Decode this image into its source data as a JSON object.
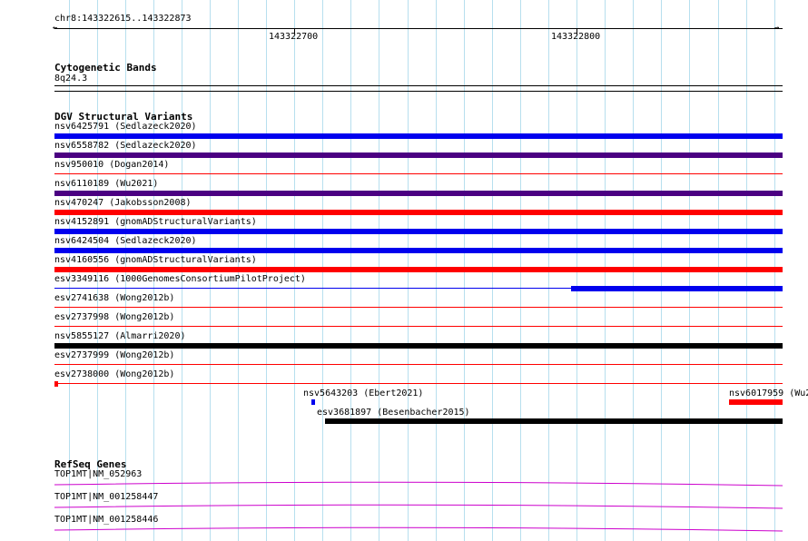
{
  "ruler": {
    "locus": "chr8:143322615..143322873",
    "ticks": [
      {
        "label": "143322700",
        "pos": 143322700
      },
      {
        "label": "143322800",
        "pos": 143322800
      }
    ],
    "start": 143322615,
    "end": 143322873,
    "left_arrow": "←",
    "right_arrow": "→"
  },
  "cytoband": {
    "title": "Cytogenetic Bands",
    "band": "8q24.3"
  },
  "dgv": {
    "title": "DGV Structural Variants",
    "colors": {
      "blue": "#0000ee",
      "purple": "#4b0082",
      "red": "#ff0000",
      "black": "#000000"
    },
    "tracks": [
      {
        "label": "nsv6425791 (Sedlazeck2020)",
        "color": "blue",
        "start": 143322615,
        "end": 143322873
      },
      {
        "label": "nsv6558782 (Sedlazeck2020)",
        "color": "purple",
        "start": 143322615,
        "end": 143322873
      },
      {
        "label": "nsv950010 (Dogan2014)",
        "color": "red",
        "start": null,
        "end": null
      },
      {
        "label": "nsv6110189 (Wu2021)",
        "color": "purple",
        "start": 143322615,
        "end": 143322873
      },
      {
        "label": "nsv470247 (Jakobsson2008)",
        "color": "red",
        "start": 143322615,
        "end": 143322873
      },
      {
        "label": "nsv4152891 (gnomADStructuralVariants)",
        "color": "blue",
        "start": 143322615,
        "end": 143322873
      },
      {
        "label": "nsv6424504 (Sedlazeck2020)",
        "color": "blue",
        "start": 143322615,
        "end": 143322873
      },
      {
        "label": "nsv4160556 (gnomADStructuralVariants)",
        "color": "red",
        "start": 143322615,
        "end": 143322873
      },
      {
        "label": "esv3349116 (1000GenomesConsortiumPilotProject)",
        "color": "blue",
        "start": 143322798,
        "end": 143322873
      },
      {
        "label": "esv2741638 (Wong2012b)",
        "color": "red",
        "start": null,
        "end": null
      },
      {
        "label": "esv2737998 (Wong2012b)",
        "color": "red",
        "start": null,
        "end": null
      },
      {
        "label": "nsv5855127 (Almarri2020)",
        "color": "black",
        "start": 143322615,
        "end": 143322873
      },
      {
        "label": "esv2737999 (Wong2012b)",
        "color": "red",
        "start": null,
        "end": null
      },
      {
        "label": "esv2738000 (Wong2012b)",
        "color": "red",
        "start": 143322615,
        "end": 143322616
      }
    ],
    "extra_features": [
      {
        "label": "nsv5643203 (Ebert2021)",
        "color": "blue",
        "start": 143322706,
        "end": 143322707
      },
      {
        "label": "nsv6017959 (Wu2",
        "color": "red",
        "start": 143322854,
        "end": 143322873
      },
      {
        "label": "esv3681897 (Besenbacher2015)",
        "color": "black",
        "start": 143322711,
        "end": 143322873
      }
    ]
  },
  "refseq": {
    "title": "RefSeq Genes",
    "color": "#cc00cc",
    "genes": [
      {
        "label": "TOP1MT|NM_052963"
      },
      {
        "label": "TOP1MT|NM_001258447"
      },
      {
        "label": "TOP1MT|NM_001258446"
      }
    ]
  }
}
